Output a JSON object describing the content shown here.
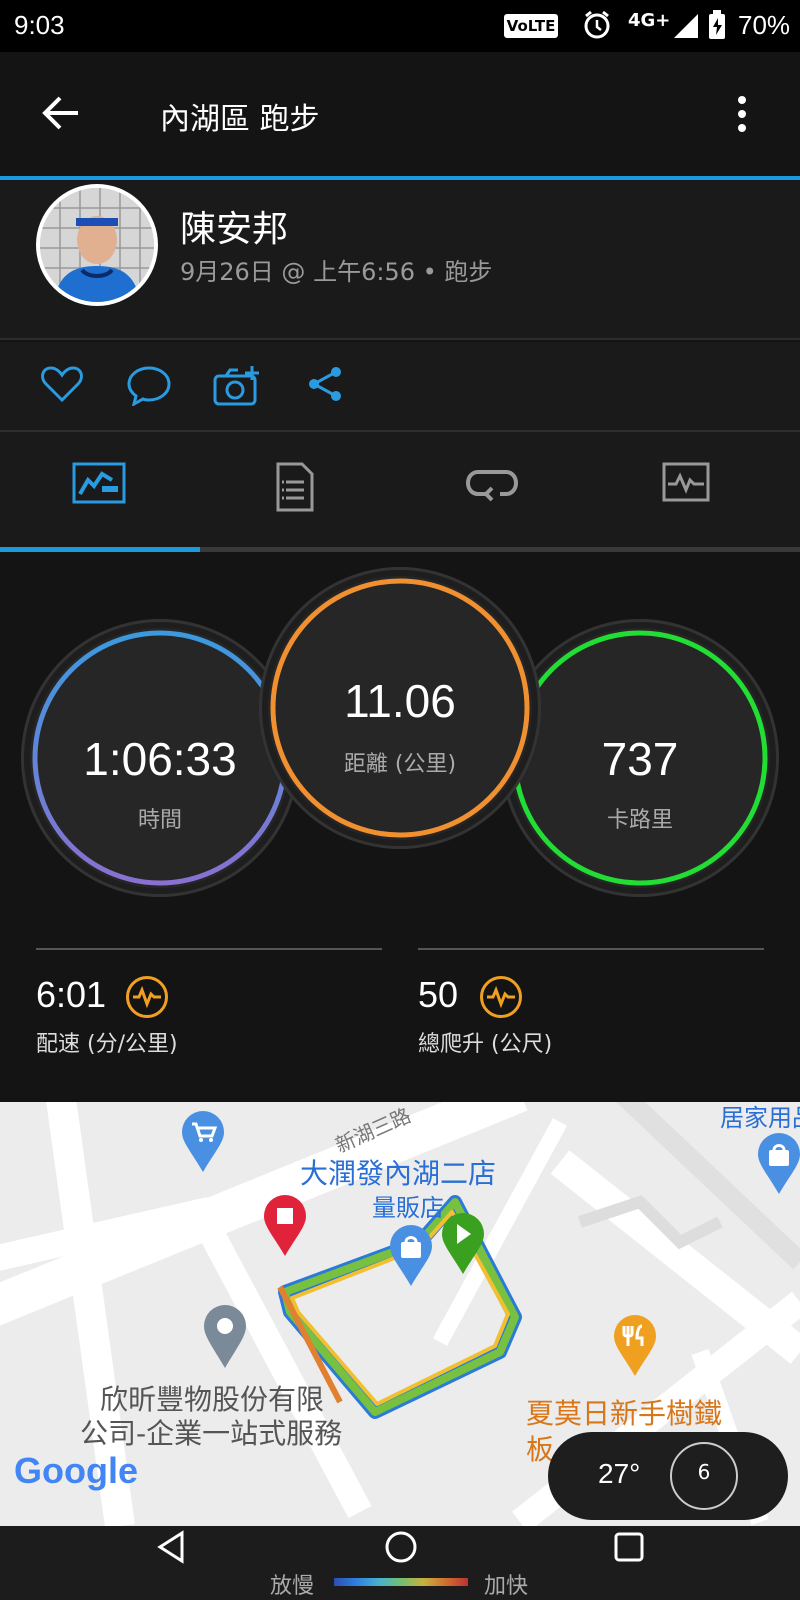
{
  "status_bar": {
    "time": "9:03",
    "volte": "VoLTE",
    "network": "4G+",
    "battery": "70%"
  },
  "app_bar": {
    "title": "內湖區 跑步",
    "back_icon": "arrow-left-icon",
    "menu_icon": "more-vert-icon"
  },
  "profile": {
    "name": "陳安邦",
    "meta": "9月26日 @ 上午6:56 • 跑步"
  },
  "actions": [
    "heart-icon",
    "comment-icon",
    "add-photo-icon",
    "share-icon"
  ],
  "tabs": [
    {
      "icon": "overview-icon",
      "active": true
    },
    {
      "icon": "details-icon",
      "active": false
    },
    {
      "icon": "laps-icon",
      "active": false
    },
    {
      "icon": "charts-icon",
      "active": false
    }
  ],
  "stats": {
    "time": {
      "value": "1:06:33",
      "label": "時間"
    },
    "distance": {
      "value": "11.06",
      "label": "距離 (公里)"
    },
    "calories": {
      "value": "737",
      "label": "卡路里"
    },
    "pace": {
      "value": "6:01",
      "label": "配速 (分/公里)"
    },
    "ascent": {
      "value": "50",
      "label": "總爬升 (公尺)"
    }
  },
  "map": {
    "street": "新湖三路",
    "store_name": "大潤發內湖二店",
    "store_type": "量販店",
    "company_line1": "欣昕豐物股份有限",
    "company_line2": "公司-企業一站式服務",
    "top_right": "居家用品",
    "bottom_right_1": "夏莫日新手樹鐵",
    "bottom_right_2": "板",
    "google": "Google",
    "weather_temp": "27°",
    "wind": "6"
  },
  "colors": {
    "accent": "#1a9be0",
    "distance_ring": "#f09030",
    "calorie_ring": "#22dd33",
    "time_ring_top": "#3a9ae0",
    "time_ring_bottom": "#8a70d0"
  },
  "nav": {
    "slow_label": "放慢",
    "fast_label": "加快"
  }
}
